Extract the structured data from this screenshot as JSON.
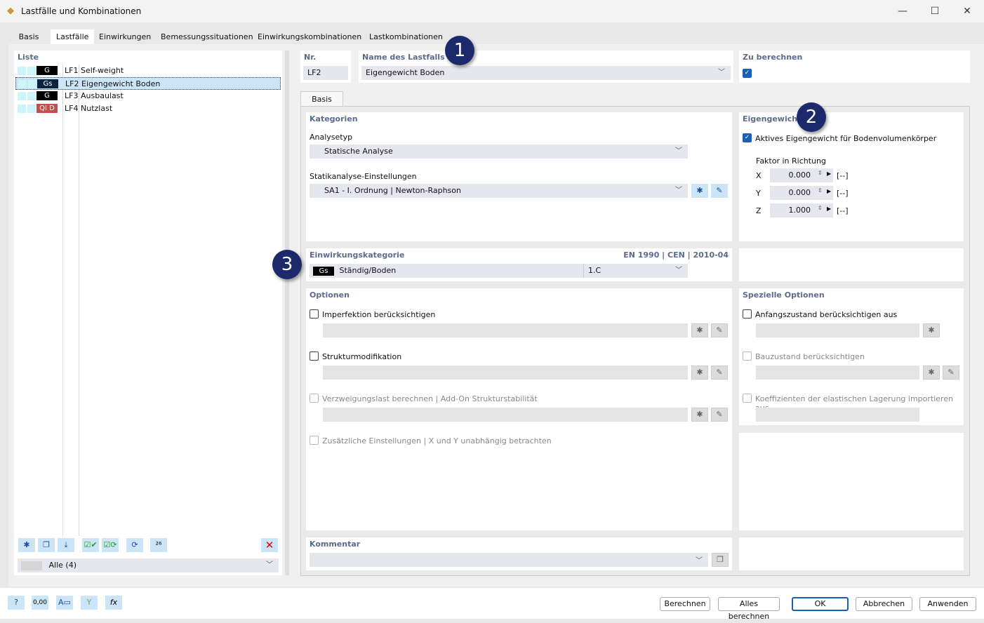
{
  "window": {
    "title": "Lastfälle und Kombinationen",
    "icons": [
      "app-icon",
      "minimize-icon",
      "maximize-icon",
      "close-icon"
    ]
  },
  "tabs": [
    "Basis",
    "Lastfälle",
    "Einwirkungen",
    "Bemessungssituationen",
    "Einwirkungskombinationen",
    "Lastkombinationen"
  ],
  "active_tab": "Lastfälle",
  "list": {
    "title": "Liste",
    "items": [
      {
        "tag": "G",
        "tag_color": "#000000",
        "id": "LF1",
        "name": "Self-weight"
      },
      {
        "tag": "Gs",
        "tag_color": "#0b2340",
        "id": "LF2",
        "name": "Eigengewicht Boden",
        "selected": true
      },
      {
        "tag": "G",
        "tag_color": "#000000",
        "id": "LF3",
        "name": "Ausbaulast"
      },
      {
        "tag": "QI D",
        "tag_color": "#c0504d",
        "id": "LF4",
        "name": "Nutzlast"
      }
    ],
    "filter": "Alle (4)"
  },
  "header": {
    "nr_label": "Nr.",
    "nr_value": "LF2",
    "name_label": "Name des Lastfalls",
    "name_value": "Eigengewicht Boden",
    "calc_label": "Zu berechnen",
    "calc_checked": true
  },
  "inner_tab": "Basis",
  "kategorien": {
    "title": "Kategorien",
    "analysetyp_label": "Analysetyp",
    "analysetyp": "Statische Analyse",
    "statik_label": "Statikanalyse-Einstellungen",
    "statik": "SA1 - I. Ordnung | Newton-Raphson"
  },
  "eigengewicht": {
    "title": "Eigengewicht",
    "active_label": "Aktives Eigengewicht für Bodenvolumenkörper",
    "active": true,
    "factor_label": "Faktor in Richtung",
    "factors": [
      {
        "axis": "X",
        "value": "0.000",
        "unit": "[--]"
      },
      {
        "axis": "Y",
        "value": "0.000",
        "unit": "[--]"
      },
      {
        "axis": "Z",
        "value": "1.000",
        "unit": "[--]"
      }
    ]
  },
  "einwirkung": {
    "title": "Einwirkungskategorie",
    "norm": "EN 1990 | CEN | 2010-04",
    "tag": "Gs",
    "value": "Ständig/Boden",
    "code": "1.C"
  },
  "optionen": {
    "title": "Optionen",
    "items": [
      {
        "label": "Imperfektion berücksichtigen",
        "enabled": true
      },
      {
        "label": "Strukturmodifikation",
        "enabled": true
      },
      {
        "label": "Verzweigungslast berechnen | Add-On Strukturstabilität",
        "enabled": false
      },
      {
        "label": "Zusätzliche Einstellungen | X und Y unabhängig betrachten",
        "enabled": false
      }
    ]
  },
  "spezielle": {
    "title": "Spezielle Optionen",
    "items": [
      {
        "label": "Anfangszustand berücksichtigen aus",
        "enabled": true
      },
      {
        "label": "Bauzustand berücksichtigen",
        "enabled": false
      },
      {
        "label": "Koeffizienten der elastischen Lagerung importieren aus",
        "enabled": false
      }
    ]
  },
  "kommentar": {
    "title": "Kommentar",
    "value": ""
  },
  "callouts": [
    "1",
    "2",
    "3"
  ],
  "buttons": {
    "berechnen": "Berechnen",
    "alles": "Alles berechnen",
    "ok": "OK",
    "abbrechen": "Abbrechen",
    "anwenden": "Anwenden"
  },
  "bottom_icons": [
    "help-icon",
    "units-icon",
    "display-icon",
    "model-icon",
    "formula-icon"
  ],
  "list_tools": [
    "new-icon",
    "copy-icon",
    "import-icon",
    "check-all-icon",
    "toggle-icon",
    "renumber-icon",
    "renumber-to-icon",
    "delete-icon"
  ],
  "accent": "#1a5fb4"
}
